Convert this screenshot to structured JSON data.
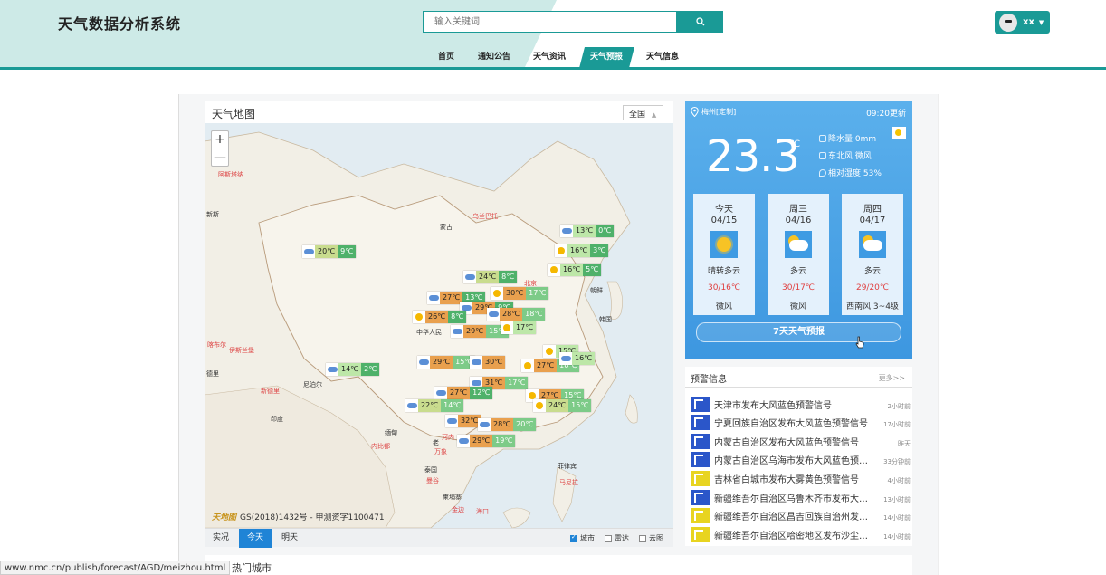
{
  "header": {
    "title": "天气数据分析系统",
    "search_placeholder": "输入关键词",
    "user_name": "xx"
  },
  "nav": {
    "items": [
      {
        "label": "首页"
      },
      {
        "label": "通知公告"
      },
      {
        "label": "天气资讯"
      },
      {
        "label": "天气预报"
      },
      {
        "label": "天气信息"
      }
    ],
    "active_index": 3
  },
  "map": {
    "title": "天气地图",
    "scope": "全国",
    "zoom_in": "+",
    "zoom_out": "—",
    "credit_logo": "天地图",
    "credit": "GS(2018)1432号 - 甲测资字1100471",
    "labels": [
      "阿斯塔纳",
      "新斯",
      "乌兰巴托",
      "蒙古",
      "北京",
      "朝鲜",
      "韩国",
      "中华人民",
      "喀布尔",
      "伊斯兰堡",
      "新德里",
      "尼泊尔",
      "印度",
      "德里",
      "缅甸",
      "内比都",
      "老",
      "万象",
      "泰国",
      "曼谷",
      "柬埔寨",
      "金边",
      "菲律宾",
      "马尼拉",
      "河内",
      "海口"
    ],
    "weather_tags": [
      {
        "hi": "20℃",
        "lo": "9℃",
        "icon": "cloud"
      },
      {
        "hi": "13℃",
        "lo": "0℃",
        "icon": "cloud"
      },
      {
        "hi": "16℃",
        "lo": "3℃",
        "icon": "sun"
      },
      {
        "hi": "16℃",
        "lo": "5℃",
        "icon": "sun"
      },
      {
        "hi": "24℃",
        "lo": "8℃",
        "icon": "cloud"
      },
      {
        "hi": "27℃",
        "lo": "13℃",
        "icon": "cloud"
      },
      {
        "hi": "30℃",
        "lo": "17℃",
        "icon": "sun"
      },
      {
        "hi": "29℃",
        "lo": "9℃",
        "icon": "cloud"
      },
      {
        "hi": "28℃",
        "lo": "18℃",
        "icon": "cloud"
      },
      {
        "hi": "26℃",
        "lo": "8℃",
        "icon": "sun"
      },
      {
        "hi": "29℃",
        "lo": "15℃",
        "icon": "cloud"
      },
      {
        "hi": "17℃",
        "lo": "",
        "icon": "sun"
      },
      {
        "hi": "14℃",
        "lo": "2℃",
        "icon": "cloud"
      },
      {
        "hi": "29℃",
        "lo": "15℃",
        "icon": "cloud"
      },
      {
        "hi": "30℃",
        "lo": "",
        "icon": "cloud"
      },
      {
        "hi": "27℃",
        "lo": "16℃",
        "icon": "sun"
      },
      {
        "hi": "15℃",
        "lo": "",
        "icon": "sun"
      },
      {
        "hi": "16℃",
        "lo": "",
        "icon": "cloud"
      },
      {
        "hi": "31℃",
        "lo": "17℃",
        "icon": "cloud"
      },
      {
        "hi": "27℃",
        "lo": "12℃",
        "icon": "cloud"
      },
      {
        "hi": "27℃",
        "lo": "15℃",
        "icon": "sun"
      },
      {
        "hi": "22℃",
        "lo": "14℃",
        "icon": "cloud"
      },
      {
        "hi": "24℃",
        "lo": "15℃",
        "icon": "sun"
      },
      {
        "hi": "32℃",
        "lo": "",
        "icon": "cloud"
      },
      {
        "hi": "28℃",
        "lo": "20℃",
        "icon": "cloud"
      },
      {
        "hi": "29℃",
        "lo": "19℃",
        "icon": "cloud"
      }
    ],
    "tabs": [
      "实况",
      "今天",
      "明天"
    ],
    "active_tab": 1,
    "layers": [
      {
        "label": "城市",
        "checked": true
      },
      {
        "label": "雷达",
        "checked": false
      },
      {
        "label": "云图",
        "checked": false
      }
    ]
  },
  "weather": {
    "location": "梅州[定制]",
    "update": "09:20更新",
    "temp": "23.3",
    "unit": "℃",
    "rain": "降水量 0mm",
    "wind": "东北风 微风",
    "humidity": "相对湿度 53%",
    "days": [
      {
        "name": "今天",
        "date": "04/15",
        "desc": "晴转多云",
        "temp": "30/16℃",
        "wind": "微风",
        "icon": "sun"
      },
      {
        "name": "周三",
        "date": "04/16",
        "desc": "多云",
        "temp": "30/17℃",
        "wind": "微风",
        "icon": "cloud"
      },
      {
        "name": "周四",
        "date": "04/17",
        "desc": "多云",
        "temp": "29/20℃",
        "wind": "西南风 3~4级",
        "icon": "cloud"
      }
    ],
    "forecast_button": "7天天气预报"
  },
  "warnings": {
    "title": "预警信息",
    "more": "更多>>",
    "items": [
      {
        "text": "天津市发布大风蓝色预警信号",
        "time": "2小时前",
        "color": "blue"
      },
      {
        "text": "宁夏回族自治区发布大风蓝色预警信号",
        "time": "17小时前",
        "color": "blue"
      },
      {
        "text": "内蒙古自治区发布大风蓝色预警信号",
        "time": "昨天",
        "color": "blue"
      },
      {
        "text": "内蒙古自治区乌海市发布大风蓝色预警信号",
        "time": "33分钟前",
        "color": "blue"
      },
      {
        "text": "吉林省白城市发布大雾黄色预警信号",
        "time": "4小时前",
        "color": "yellow"
      },
      {
        "text": "新疆维吾尔自治区乌鲁木齐市发布大风蓝色预警信号",
        "time": "13小时前",
        "color": "blue"
      },
      {
        "text": "新疆维吾尔自治区昌吉回族自治州发布大风黄色预警信号",
        "time": "14小时前",
        "color": "yellow"
      },
      {
        "text": "新疆维吾尔自治区哈密地区发布沙尘暴黄色预警信号",
        "time": "14小时前",
        "color": "yellow"
      }
    ]
  },
  "hot": {
    "title": "热门城市"
  },
  "status_url": "www.nmc.cn/publish/forecast/AGD/meizhou.html",
  "colors": {
    "accent": "#1a9a96",
    "blue": "#3d97e0",
    "warn_blue": "#2b56c9",
    "warn_yellow": "#e8d420"
  }
}
